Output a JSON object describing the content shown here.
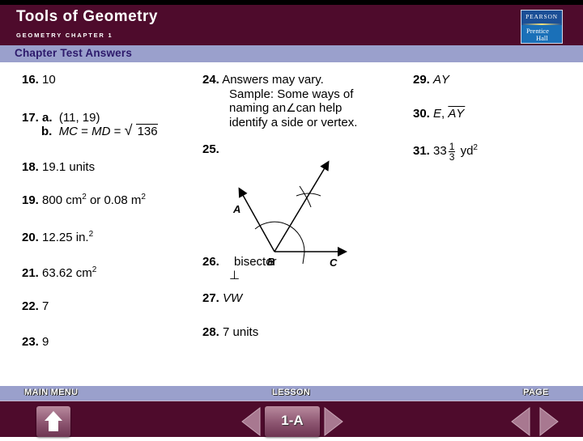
{
  "header": {
    "title": "Tools of Geometry",
    "subtitle": "GEOMETRY CHAPTER 1",
    "section": "Chapter Test Answers",
    "logo": {
      "top": "PEARSON",
      "line1": "Prentice",
      "line2": "Hall"
    }
  },
  "answers": {
    "a16": {
      "num": "16.",
      "text": "10"
    },
    "a17": {
      "num": "17.",
      "a_label": "a.",
      "a_text": "(11, 19)",
      "b_label": "b.",
      "b_var1": "MC",
      "b_eq": " = ",
      "b_var2": "MD",
      "b_eq2": " = ",
      "b_radicand": "136"
    },
    "a18": {
      "num": "18.",
      "text": "19.1 units"
    },
    "a19": {
      "num": "19.",
      "t1": "800 cm",
      "s1": "2",
      "t2": " or 0.08 m",
      "s2": "2"
    },
    "a20": {
      "num": "20.",
      "t1": "12.25 in.",
      "s1": "2"
    },
    "a21": {
      "num": "21.",
      "t1": "63.62 cm",
      "s1": "2"
    },
    "a22": {
      "num": "22.",
      "text": "7"
    },
    "a23": {
      "num": "23.",
      "text": "9"
    },
    "a24": {
      "num": "24.",
      "lines": [
        "Answers may vary.",
        "Sample: Some ways of",
        "naming an",
        "can help",
        "identify a side or vertex."
      ],
      "angle_symbol": "∠"
    },
    "a25": {
      "num": "25.",
      "diagram": {
        "labels": {
          "A": "A",
          "B": "B",
          "C": "C"
        }
      }
    },
    "a26": {
      "num": "26.",
      "text": "bisector",
      "symbol": "⊥"
    },
    "a27": {
      "num": "27.",
      "text": "VW"
    },
    "a28": {
      "num": "28.",
      "text": "7 units"
    },
    "a29": {
      "num": "29.",
      "text": "AY"
    },
    "a30": {
      "num": "30.",
      "t1": "E",
      "sep": ", ",
      "t2": "AY"
    },
    "a31": {
      "num": "31.",
      "whole": "33",
      "numerator": "1",
      "denominator": "3",
      "unit": "yd",
      "sup": "2"
    }
  },
  "nav": {
    "main_menu": "MAIN MENU",
    "lesson": "LESSON",
    "lesson_value": "1-A",
    "page": "PAGE"
  },
  "colors": {
    "maroon": "#4e0b2c",
    "lavender": "#9aa0cc",
    "section_text": "#2d1a6b",
    "logo_blue": "#1a70b8"
  }
}
